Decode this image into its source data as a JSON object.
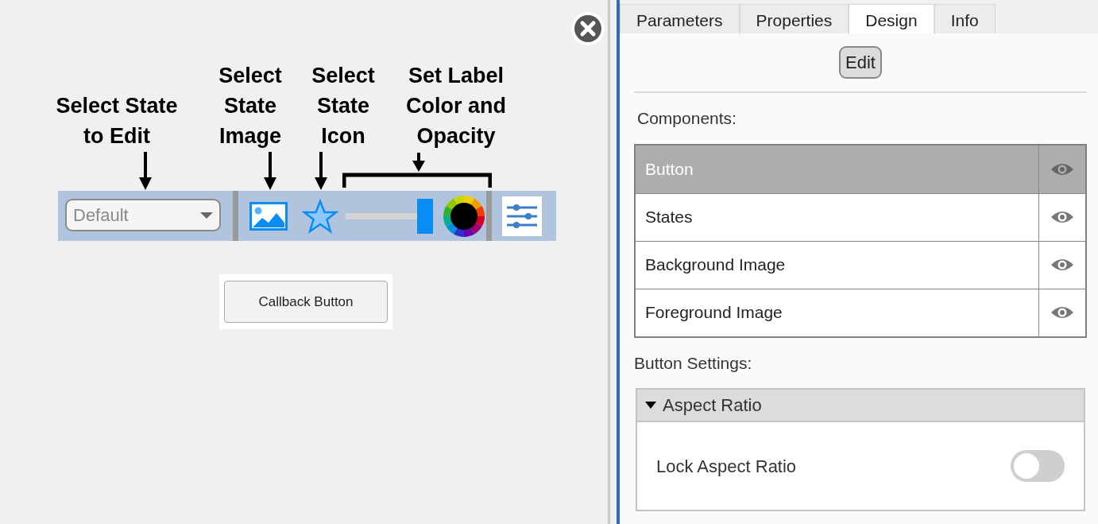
{
  "annotations": [
    {
      "lines": [
        "Select State",
        "to Edit"
      ],
      "kind": "arrow"
    },
    {
      "lines": [
        "Select",
        "State",
        "Image"
      ],
      "kind": "arrow"
    },
    {
      "lines": [
        "Select",
        "State",
        "Icon"
      ],
      "kind": "arrow"
    },
    {
      "lines": [
        "Set Label",
        "Color and",
        "Opacity"
      ],
      "kind": "bracket"
    }
  ],
  "toolbar": {
    "state_dropdown": {
      "value": "Default",
      "disabled": true
    },
    "opacity_slider": {
      "level": 1
    }
  },
  "callback_button": {
    "label": "Callback Button"
  },
  "tabs": [
    {
      "label": "Parameters",
      "selected": false
    },
    {
      "label": "Properties",
      "selected": false
    },
    {
      "label": "Design",
      "selected": true
    },
    {
      "label": "Info",
      "selected": false
    }
  ],
  "edit_button": {
    "label": "Edit"
  },
  "components": {
    "label": "Components:",
    "rows": [
      {
        "name": "Button",
        "selected": true
      },
      {
        "name": "States",
        "selected": false
      },
      {
        "name": "Background Image",
        "selected": false
      },
      {
        "name": "Foreground Image",
        "selected": false
      }
    ]
  },
  "button_settings": {
    "label": "Button Settings:",
    "section": {
      "title": "Aspect Ratio",
      "expanded": true,
      "settings": [
        {
          "label": "Lock Aspect Ratio",
          "on": false
        }
      ]
    }
  }
}
